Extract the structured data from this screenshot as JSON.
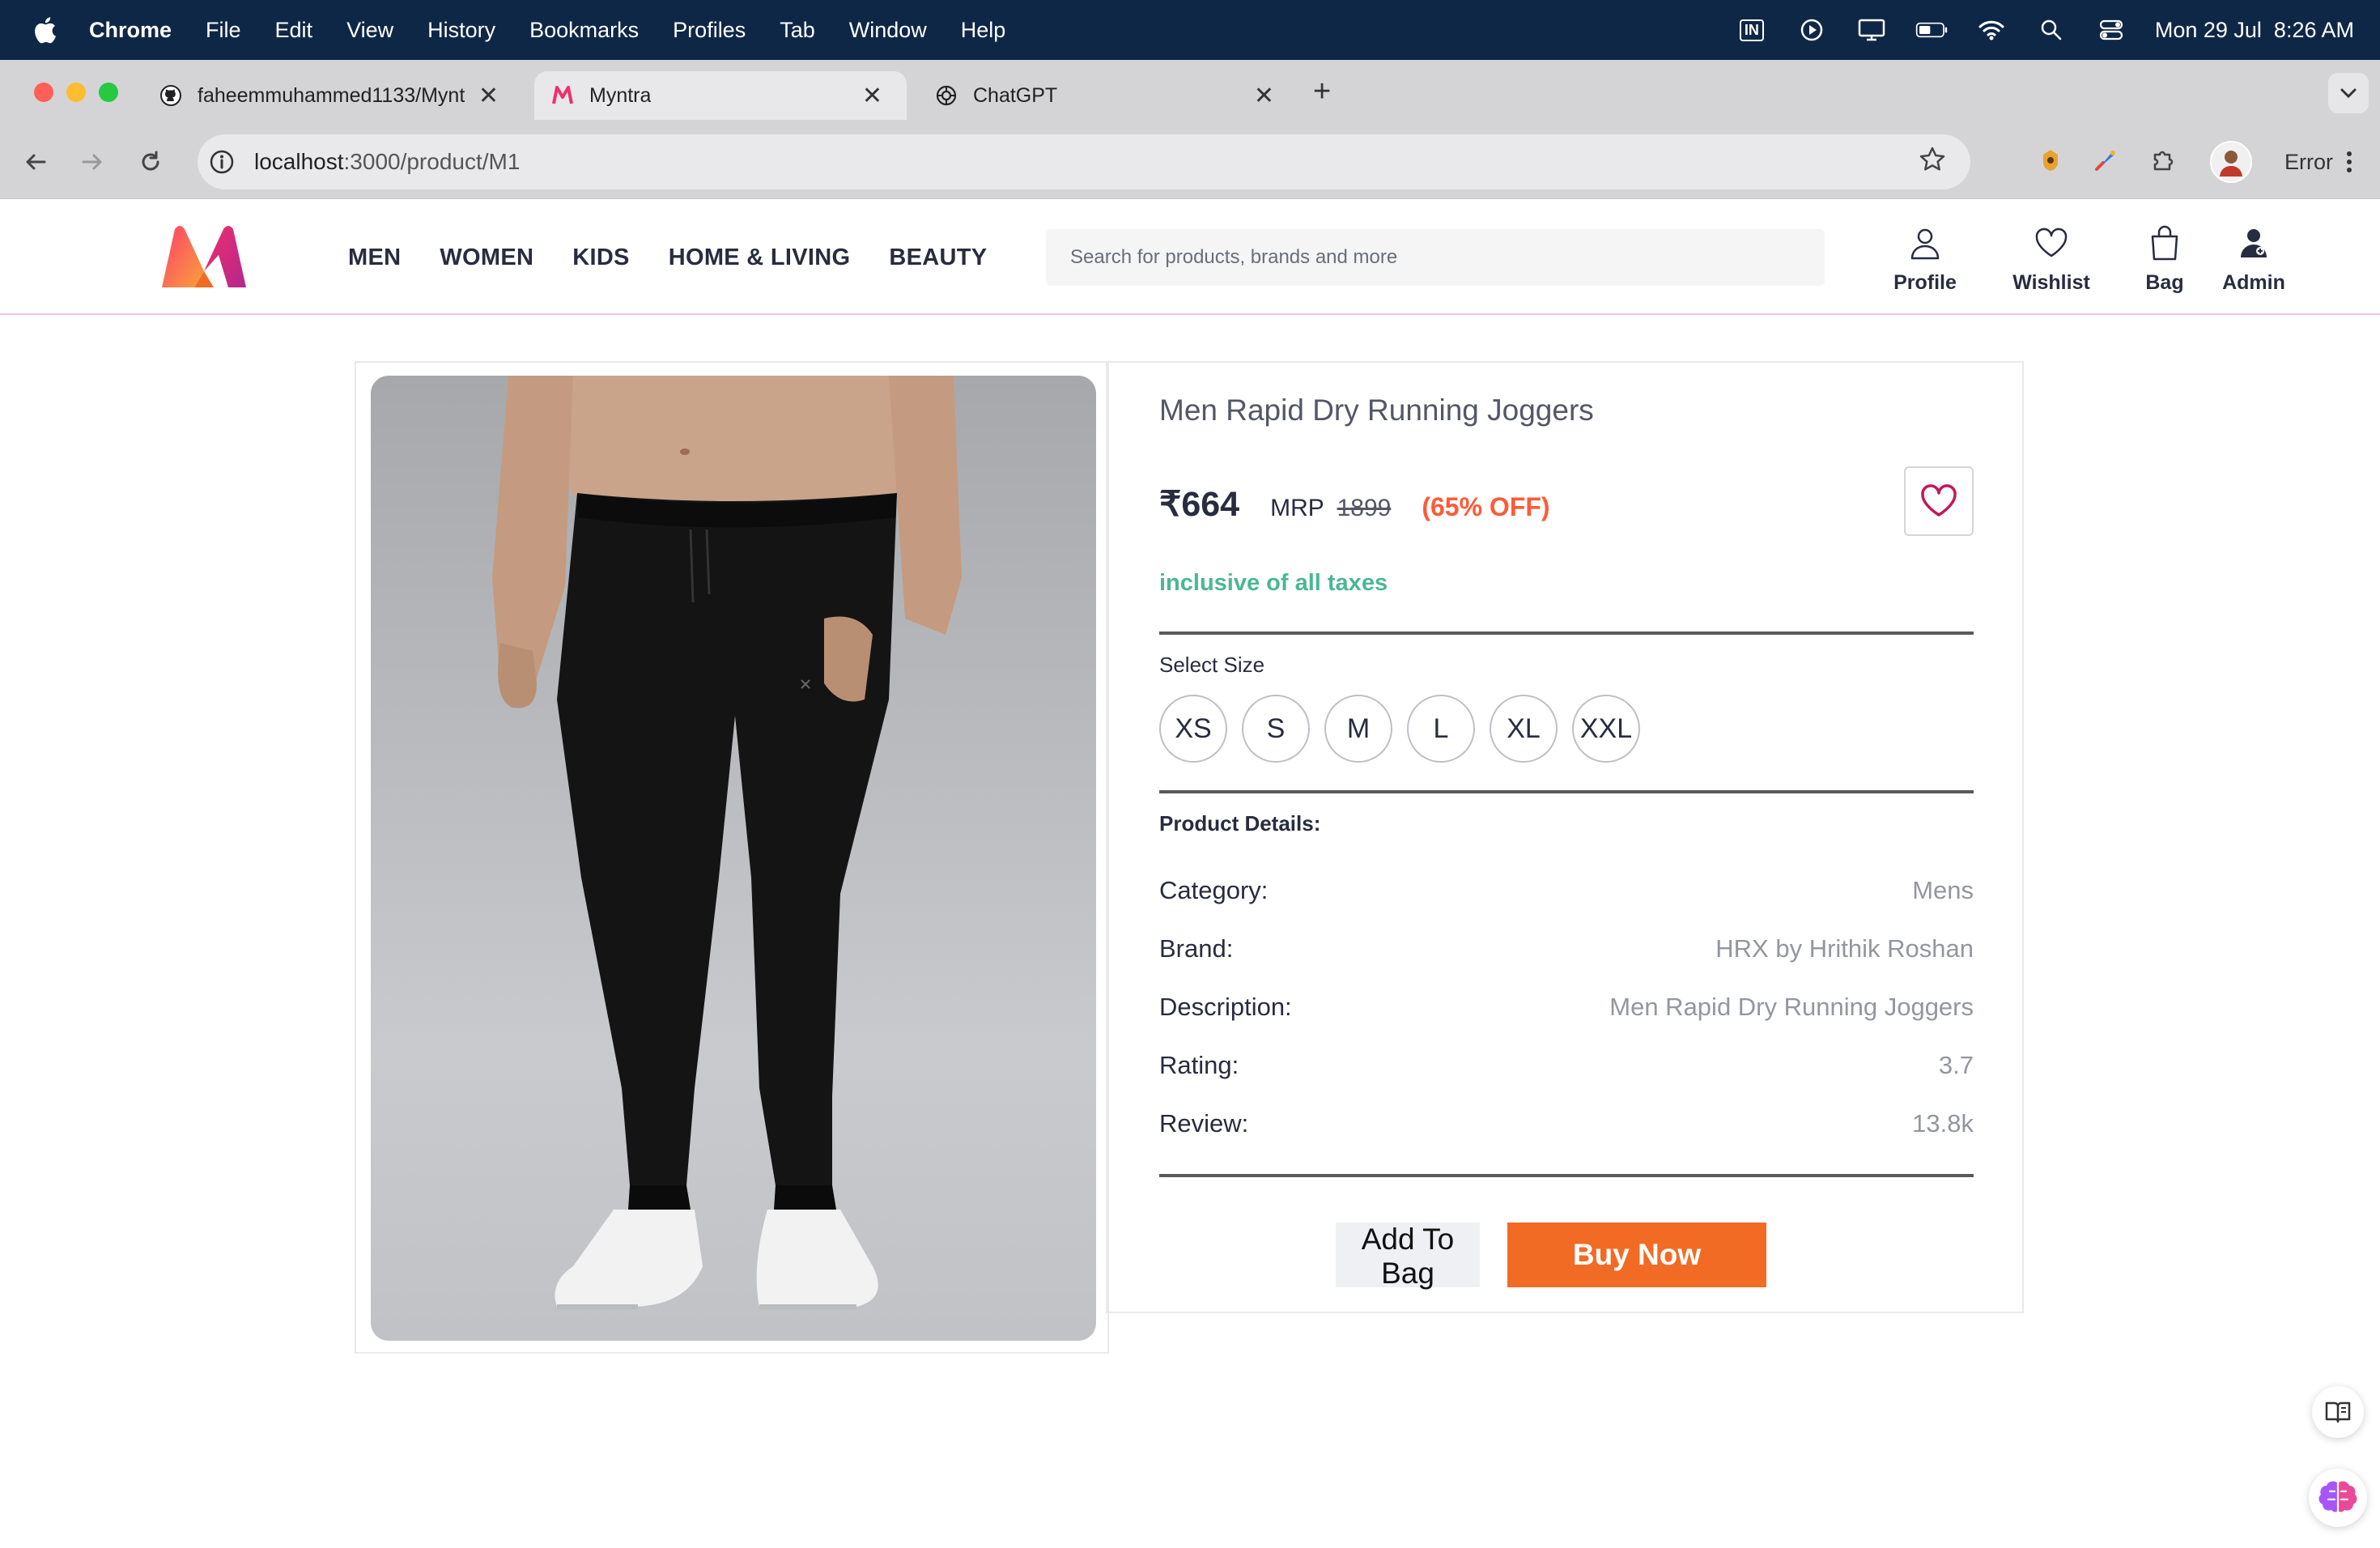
{
  "os_menubar": {
    "app": "Chrome",
    "items": [
      "File",
      "Edit",
      "View",
      "History",
      "Bookmarks",
      "Profiles",
      "Tab",
      "Window",
      "Help"
    ],
    "input_source": "IN",
    "clock": "Mon 29 Jul  8:26 AM"
  },
  "browser": {
    "tabs": [
      {
        "title": "faheemmuhammed1133/Myntra",
        "icon": "github-icon",
        "active": false
      },
      {
        "title": "Myntra",
        "icon": "myntra-icon",
        "active": true
      },
      {
        "title": "ChatGPT",
        "icon": "chatgpt-icon",
        "active": false
      }
    ],
    "url_host": "localhost",
    "url_path": ":3000/product/M1",
    "profile_status": "Error"
  },
  "header": {
    "nav": [
      "MEN",
      "WOMEN",
      "KIDS",
      "HOME & LIVING",
      "BEAUTY"
    ],
    "search_placeholder": "Search for products, brands and more",
    "actions": [
      {
        "label": "Profile",
        "icon": "profile-icon"
      },
      {
        "label": "Wishlist",
        "icon": "heart-icon"
      },
      {
        "label": "Bag",
        "icon": "bag-icon"
      },
      {
        "label": "Admin",
        "icon": "admin-icon"
      }
    ]
  },
  "product": {
    "title": "Men Rapid Dry Running Joggers",
    "price": "₹664",
    "mrp_label": "MRP",
    "mrp_value": "1899",
    "discount": "(65% OFF)",
    "tax_note": "inclusive of all taxes",
    "size_label": "Select Size",
    "sizes": [
      "XS",
      "S",
      "M",
      "L",
      "XL",
      "XXL"
    ],
    "details_label": "Product Details:",
    "details": [
      {
        "key": "Category:",
        "value": "Mens"
      },
      {
        "key": "Brand:",
        "value": "HRX by Hrithik Roshan"
      },
      {
        "key": "Description:",
        "value": "Men Rapid Dry Running Joggers"
      },
      {
        "key": "Rating:",
        "value": "3.7"
      },
      {
        "key": "Review:",
        "value": "13.8k"
      }
    ],
    "add_to_bag": "Add To Bag",
    "buy_now": "Buy Now"
  },
  "colors": {
    "accent_orange": "#f26b25",
    "discount": "#ff5a36",
    "tax_green": "#1fa67a",
    "wish_pink": "#c2185b"
  }
}
